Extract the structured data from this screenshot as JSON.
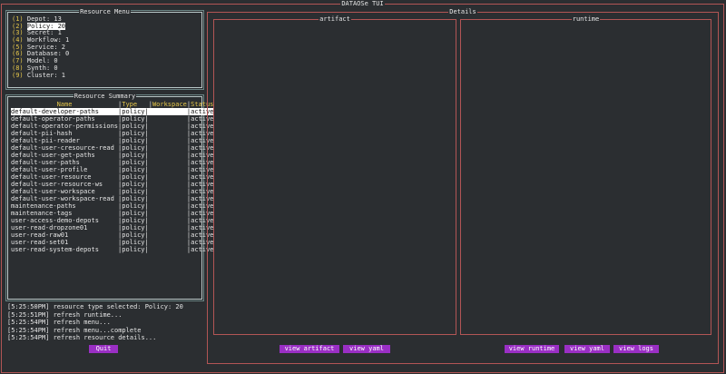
{
  "app": {
    "title": "DATAOSe TUI"
  },
  "menu": {
    "title": "Resource Menu",
    "items": [
      {
        "num": "(1)",
        "label": "Depot: 13"
      },
      {
        "num": "(2)",
        "label": "Policy: 20",
        "selected": true
      },
      {
        "num": "(3)",
        "label": "Secret: 1"
      },
      {
        "num": "(4)",
        "label": "Workflow: 1"
      },
      {
        "num": "(5)",
        "label": "Service: 2"
      },
      {
        "num": "(6)",
        "label": "Database: 0"
      },
      {
        "num": "(7)",
        "label": "Model: 0"
      },
      {
        "num": "(8)",
        "label": "Synth: 0"
      },
      {
        "num": "(9)",
        "label": "Cluster: 1"
      }
    ]
  },
  "summary": {
    "title": "Resource Summary",
    "headers": [
      "Name",
      "Type",
      "Workspace",
      "Status"
    ],
    "rows": [
      [
        "default-developer-paths",
        "|policy|",
        "",
        "|active"
      ],
      [
        "default-operator-paths",
        "|policy|",
        "",
        "|active"
      ],
      [
        "default-operator-permissions",
        "|policy|",
        "",
        "|active"
      ],
      [
        "default-pii-hash",
        "|policy|",
        "",
        "|active"
      ],
      [
        "default-pii-reader",
        "|policy|",
        "",
        "|active"
      ],
      [
        "default-user-cresource-read",
        "|policy|",
        "",
        "|active"
      ],
      [
        "default-user-get-paths",
        "|policy|",
        "",
        "|active"
      ],
      [
        "default-user-paths",
        "|policy|",
        "",
        "|active"
      ],
      [
        "default-user-profile",
        "|policy|",
        "",
        "|active"
      ],
      [
        "default-user-resource",
        "|policy|",
        "",
        "|active"
      ],
      [
        "default-user-resource-ws",
        "|policy|",
        "",
        "|active"
      ],
      [
        "default-user-workspace",
        "|policy|",
        "",
        "|active"
      ],
      [
        "default-user-workspace-read",
        "|policy|",
        "",
        "|active"
      ],
      [
        "maintenance-paths",
        "|policy|",
        "",
        "|active"
      ],
      [
        "maintenance-tags",
        "|policy|",
        "",
        "|active"
      ],
      [
        "user-access-demo-depots",
        "|policy|",
        "",
        "|active"
      ],
      [
        "user-read-dropzone01",
        "|policy|",
        "",
        "|active"
      ],
      [
        "user-read-raw01",
        "|policy|",
        "",
        "|active"
      ],
      [
        "user-read-set01",
        "|policy|",
        "",
        "|active"
      ],
      [
        "user-read-system-depots",
        "|policy|",
        "",
        "|active"
      ]
    ]
  },
  "log": [
    "[5:25:50PM] resource type selected: Policy: 20",
    "[5:25:51PM] refresh runtime...",
    "[5:25:54PM] refresh menu...",
    "[5:25:54PM] refresh menu...complete",
    "[5:25:54PM] refresh resource details..."
  ],
  "buttons": {
    "quit": "Quit",
    "view_artifact": "view artifact",
    "view_yaml_artifact": "view yaml",
    "view_runtime": "view runtime",
    "view_yaml_runtime": "view yaml",
    "view_logs": "view logs"
  },
  "details": {
    "title": "Details",
    "artifact_title": "artifact",
    "runtime_title": "runtime"
  },
  "colors": {
    "background": "#2b2e31",
    "accent_yellow": "#e5c64a",
    "button_purple": "#9a2fc4",
    "details_border": "#b25555"
  }
}
